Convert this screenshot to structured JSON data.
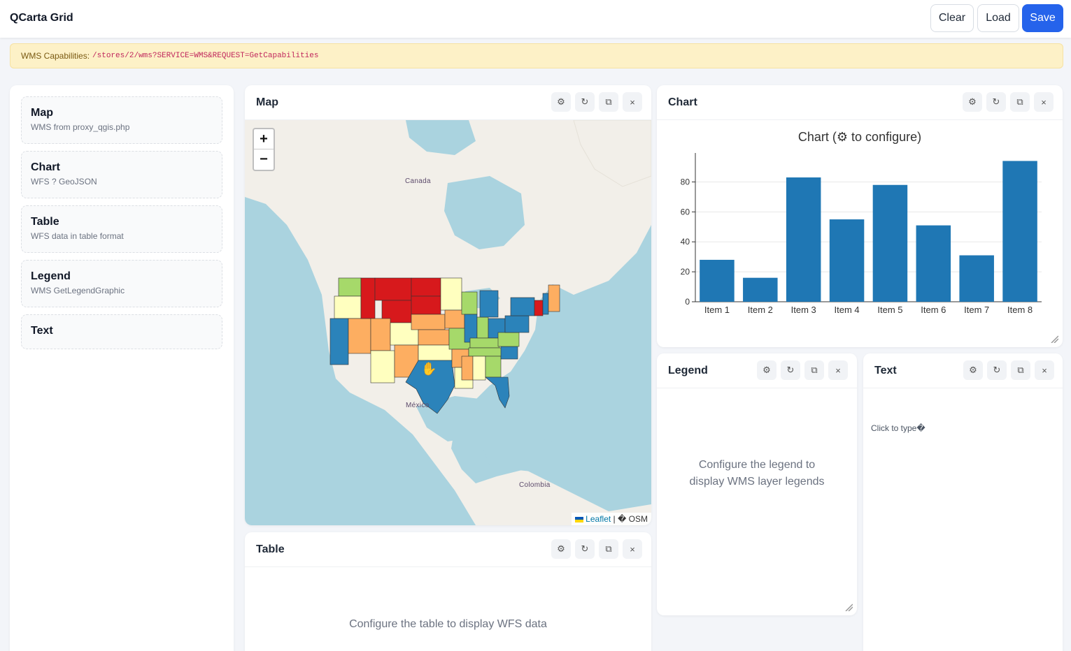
{
  "app": {
    "title": "QCarta Grid"
  },
  "toolbar": {
    "clear_label": "Clear",
    "load_label": "Load",
    "save_label": "Save"
  },
  "notice": {
    "label": "WMS Capabilities:",
    "url": "/stores/2/wms?SERVICE=WMS&REQUEST=GetCapabilities"
  },
  "sidebar": {
    "items": [
      {
        "title": "Map",
        "desc": "WMS from proxy_qgis.php"
      },
      {
        "title": "Chart",
        "desc": "WFS ? GeoJSON"
      },
      {
        "title": "Table",
        "desc": "WFS data in table format"
      },
      {
        "title": "Legend",
        "desc": "WMS GetLegendGraphic"
      },
      {
        "title": "Text",
        "desc": ""
      }
    ]
  },
  "panels": {
    "map": {
      "title": "Map",
      "zoom_in": "+",
      "zoom_out": "−",
      "labels": {
        "canada": "Canada",
        "mexico": "México",
        "colombia": "Colombia"
      },
      "attribution": {
        "leaflet": "Leaflet",
        "sep": "|",
        "osm": "� OSM"
      },
      "colors": {
        "red": "#d7191c",
        "orange": "#fdae61",
        "yellow": "#ffffbf",
        "green": "#a6d96a",
        "blue": "#2b83ba",
        "water": "#aad3df",
        "land": "#f2efe9"
      }
    },
    "chart": {
      "title": "Chart"
    },
    "table": {
      "title": "Table",
      "placeholder": "Configure the table to display WFS data"
    },
    "legend": {
      "title": "Legend",
      "placeholder": "Configure the legend to display WMS layer legends"
    },
    "text": {
      "title": "Text",
      "placeholder": "Click to type�"
    }
  },
  "controls": {
    "settings": "⚙",
    "refresh": "↻",
    "duplicate": "⧉",
    "close": "×"
  },
  "chart_data": {
    "type": "bar",
    "title": "Chart (⚙ to configure)",
    "categories": [
      "Item 1",
      "Item 2",
      "Item 3",
      "Item 4",
      "Item 5",
      "Item 6",
      "Item 7",
      "Item 8"
    ],
    "values": [
      28,
      16,
      83,
      55,
      78,
      51,
      31,
      94
    ],
    "xlabel": "",
    "ylabel": "",
    "ylim": [
      0,
      97
    ],
    "yticks": [
      0,
      20,
      40,
      60,
      80
    ],
    "bar_color": "#1f77b4",
    "grid": true
  }
}
